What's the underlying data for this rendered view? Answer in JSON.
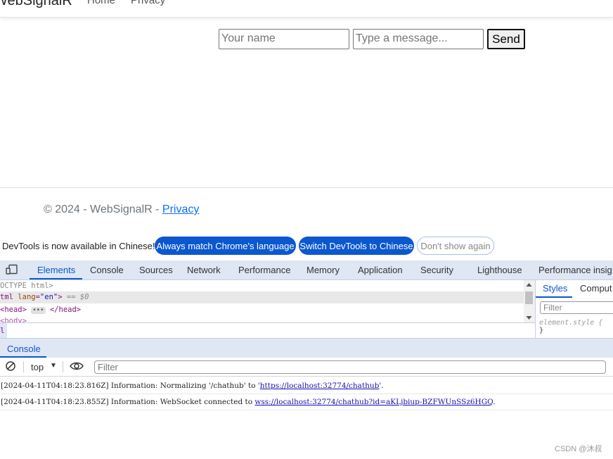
{
  "navbar": {
    "brand": "WebSignalR",
    "links": [
      "Home",
      "Privacy"
    ]
  },
  "chat": {
    "name_placeholder": "Your name",
    "message_placeholder": "Type a message...",
    "send_label": "Send"
  },
  "footer": {
    "copyright": "© 2024 - WebSignalR - ",
    "privacy_link": "Privacy"
  },
  "devtools": {
    "infobar": {
      "text": "DevTools is now available in Chinese!",
      "btn_match": "Always match Chrome's language",
      "btn_switch": "Switch DevTools to Chinese",
      "btn_dismiss": "Don't show again"
    },
    "tabs": [
      "Elements",
      "Console",
      "Sources",
      "Network",
      "Performance",
      "Memory",
      "Application",
      "Security",
      "Lighthouse",
      "Performance insig"
    ],
    "active_tab": "Elements",
    "elements": {
      "line1": "OCTYPE html>",
      "line2_tag": "tml",
      "line2_attr": "lang",
      "line2_val": "\"en\"",
      "line2_close": ">",
      "line2_suffix": "== $0",
      "line3_open": "<head>",
      "line3_close": "</head>",
      "breadcrumb": "l"
    },
    "styles": {
      "tabs": [
        "Styles",
        "Comput"
      ],
      "filter_placeholder": "Filter",
      "rule": "element.style {",
      "rule_close": "}"
    },
    "drawer": {
      "tab": "Console"
    },
    "console": {
      "context": "top",
      "filter_placeholder": "Filter",
      "logs": [
        {
          "prefix": "[2024-04-11T04:18:23.816Z] Information: Normalizing '/chathub' to '",
          "link": "https://localhost:32774/chathub",
          "suffix": "'."
        },
        {
          "prefix": "[2024-04-11T04:18:23.855Z] Information: WebSocket connected to ",
          "link": "wss://localhost:32774/chathub?id=aKLjbiup-BZFWUnSSz6HGQ",
          "suffix": "."
        }
      ]
    }
  },
  "watermark": "CSDN @沐叔"
}
